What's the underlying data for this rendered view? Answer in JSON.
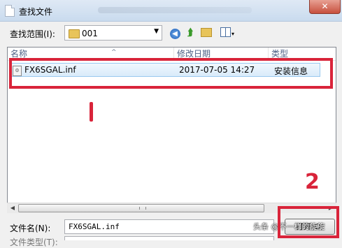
{
  "window": {
    "title": "查找文件",
    "close_label": "✕"
  },
  "lookin": {
    "label": "查找范围(I):",
    "value": "001"
  },
  "toolbar": {
    "back_glyph": "◀",
    "up_glyph": "⮭",
    "view_dropdown_glyph": "▾"
  },
  "list": {
    "columns": {
      "name": "名称",
      "date": "修改日期",
      "type": "类型"
    },
    "sort_indicator": "^",
    "rows": [
      {
        "name": "FX6SGAL.inf",
        "date": "2017-07-05 14:27",
        "type": "安装信息"
      }
    ]
  },
  "scrollbar": {
    "left_glyph": "◀",
    "right_glyph": "▶"
  },
  "filename": {
    "label": "文件名(N):",
    "value": "FX6SGAL.inf"
  },
  "filetype": {
    "label": "文件类型(T):"
  },
  "open_button": {
    "label": "打开(O)"
  },
  "watermark": {
    "text": "头条 @不一样的旋旋"
  },
  "annotations": {
    "mark1": "1",
    "mark2": "2",
    "color": "#d9243a"
  },
  "icons": [
    "folder-icon",
    "back-icon",
    "up-folder-icon",
    "new-folder-icon",
    "view-menu-icon",
    "inf-file-icon",
    "close-icon"
  ]
}
